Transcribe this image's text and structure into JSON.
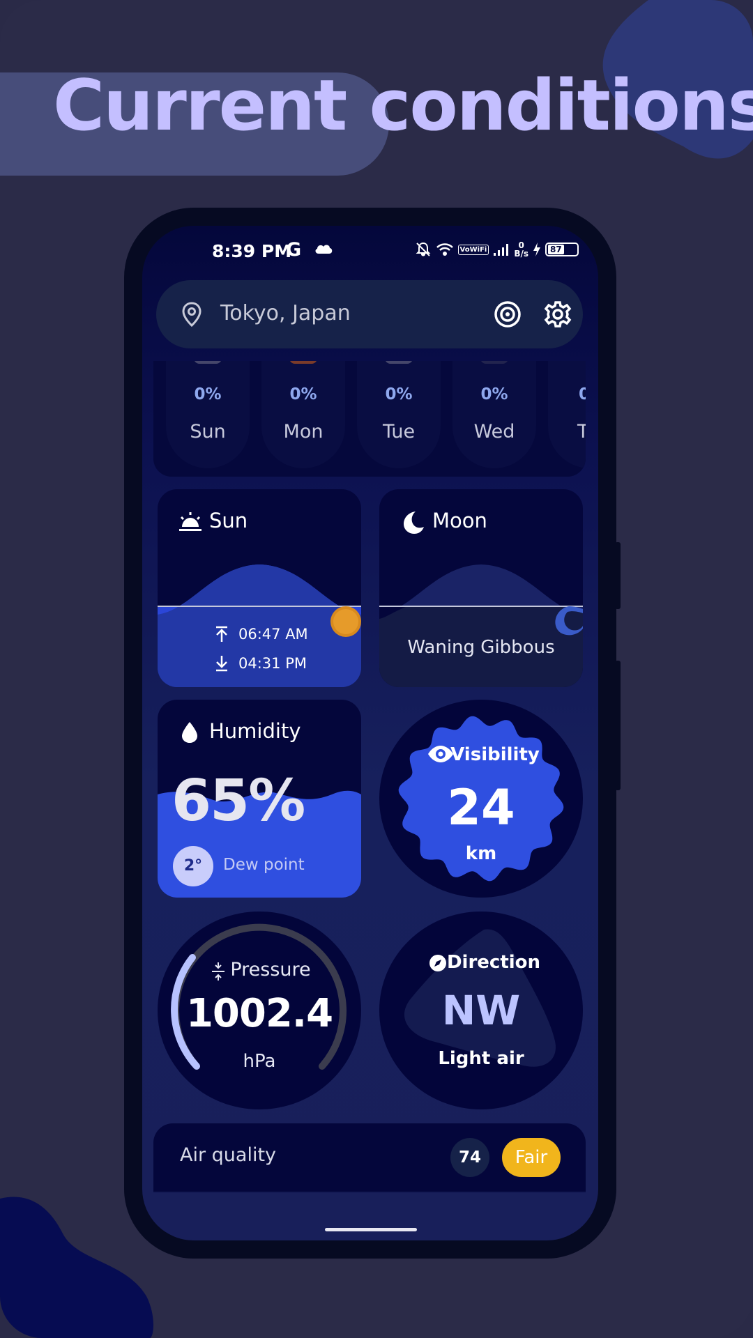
{
  "headline": "Current conditions",
  "status_bar": {
    "time": "8:39 PM",
    "carrier_glyph": "G",
    "net_speed_value": "0",
    "net_speed_unit": "B/s",
    "vowifi": "VoWiFi",
    "battery": "87",
    "icons": [
      "cloud-icon",
      "bell-off-icon",
      "wifi-icon",
      "signal-icon",
      "charging-icon",
      "battery-icon"
    ]
  },
  "search": {
    "location": "Tokyo, Japan",
    "icons": [
      "location-pin-icon",
      "radar-icon",
      "gear-icon"
    ]
  },
  "forecast": {
    "days": [
      {
        "precip": "0%",
        "day": "Sun"
      },
      {
        "precip": "0%",
        "day": "Mon"
      },
      {
        "precip": "0%",
        "day": "Tue"
      },
      {
        "precip": "0%",
        "day": "Wed"
      },
      {
        "precip": "0",
        "day": "T"
      }
    ]
  },
  "sun": {
    "label": "Sun",
    "sunrise": "06:47 AM",
    "sunset": "04:31 PM"
  },
  "moon": {
    "label": "Moon",
    "phase": "Waning Gibbous"
  },
  "humidity": {
    "label": "Humidity",
    "value": "65%",
    "level": 0.65,
    "dew_point": "2°",
    "dew_label": "Dew point"
  },
  "visibility": {
    "label": "Visibility",
    "value": "24",
    "unit": "km"
  },
  "pressure": {
    "label": "Pressure",
    "value": "1002.4",
    "unit": "hPa"
  },
  "wind": {
    "label": "Direction",
    "direction": "NW",
    "description": "Light air"
  },
  "air_quality": {
    "label": "Air quality",
    "index": "74",
    "rating": "Fair"
  },
  "colors": {
    "accent": "#2f4fe0",
    "card": "#04063b",
    "badge_fair": "#f1b51c",
    "headline": "#c4bfff"
  }
}
